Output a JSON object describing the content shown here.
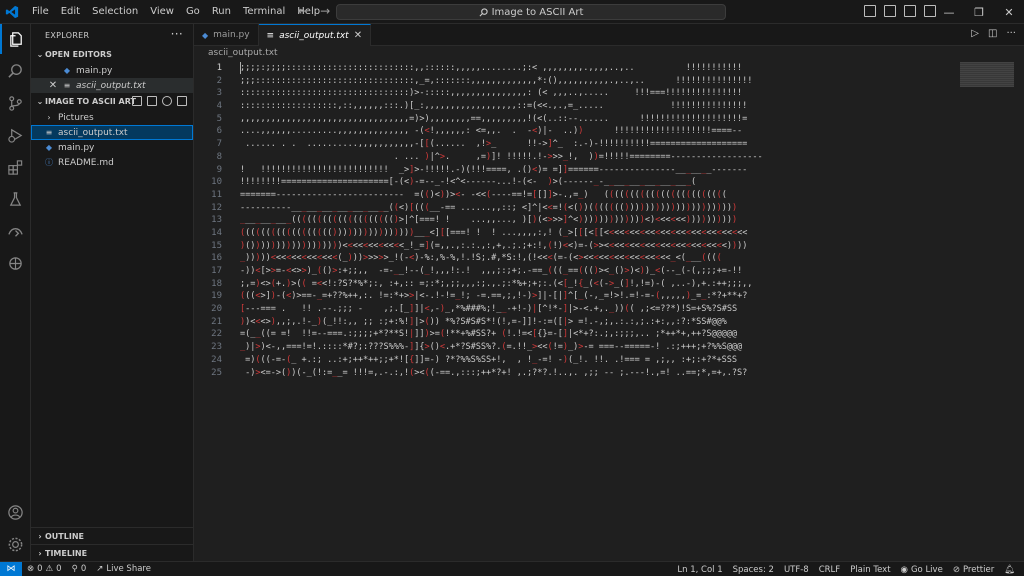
{
  "menu": [
    "File",
    "Edit",
    "Selection",
    "View",
    "Go",
    "Run",
    "Terminal",
    "Help"
  ],
  "search": {
    "text": "Image to ASCII Art"
  },
  "sidebar": {
    "title": "EXPLORER",
    "open_editors_label": "OPEN EDITORS",
    "open_editors": [
      {
        "name": "main.py",
        "icon": "python-file-icon"
      },
      {
        "name": "ascii_output.txt",
        "icon": "text-file-icon"
      }
    ],
    "folder_label": "IMAGE TO ASCII ART",
    "files": [
      {
        "name": "Pictures",
        "kind": "folder"
      },
      {
        "name": "ascii_output.txt",
        "kind": "text"
      },
      {
        "name": "main.py",
        "kind": "python"
      },
      {
        "name": "README.md",
        "kind": "info"
      }
    ],
    "outline_label": "OUTLINE",
    "timeline_label": "TIMELINE"
  },
  "tabs": [
    {
      "label": "main.py",
      "active": false
    },
    {
      "label": "ascii_output.txt",
      "active": true
    }
  ],
  "breadcrumb": "ascii_output.txt",
  "colors": {
    "accent": "#0078d4",
    "red_char": "#d23a3a"
  },
  "code_lines": [
    {
      "n": "1",
      "t": ";;;;:;;;;:::::::::::::::::::::::::,,::::::,,,,,........;:< ,,,,,,,,.,,,,..,..          !!!!!!!!!!!"
    },
    {
      "n": "2",
      "t": ";;;:::::::::::::::::::::::::::::::,_=,:::::::,,,,,,,,,,,,,*:(),,,,,,,,,,.,..,..      !!!!!!!!!!!!!!!"
    },
    {
      "n": "3",
      "t": ":::::::::::::::::::::::::::::::::)>-:::::,,,,,,,,,,,,,,,: (< ,,,..,.....     !!!===!!!!!!!!!!!!!!!"
    },
    {
      "n": "4",
      "t": ":::::::::::::::::::,::,,,,,,:::.)[_:,,,,,,,,,,,,,,,,,,::=(<<.,.,=_.....             !!!!!!!!!!!!!!!"
    },
    {
      "n": "5",
      "t": ",,,,,,,,,,,,,,,,,,,,,,,,,,,,,,,,,=)>),,,,,,,,==,,,,,,,,,!(<(..::--......      !!!!!!!!!!!!!!!!!!!!="
    },
    {
      "n": "6",
      "t": "....,,,,,,.........,,,,,,,,,,,,,, -(<!,,,,,,: <=,,.  .  -<)|-  ..))      !!!!!!!!!!!!!!!!!!!====--"
    },
    {
      "n": "7",
      "t": " ...... . .  ..........,,,,,,,,,,,-[[(......  ,!>_      !!->]^_  :.-)-!!!!!!!!!!==================="
    },
    {
      "n": "8",
      "t": "                              . ... )|^>.     ,=)]! !!!!!.!->>>_!,  ))=!!!!!========------------------"
    },
    {
      "n": "9",
      "t": "!   !!!!!!!!!!!!!!!!!!!!!!!!!  _>]>-!!!!!.-)(!!!====, .()<)= =]]======---------------_______-------"
    },
    {
      "n": "10",
      "t": "!!!!!!!!=====================[-(<)-=--_-!<^<------...!-(<-  )>(------_-_________________("
    },
    {
      "n": "11",
      "t": "=======-------------------------  =(()<))><- -<<(----==!=[[]]>-.,=_)   (((((((((((((((((((((((("
    },
    {
      "n": "12",
      "t": "----------___________________((<)[(((__-== ......,,::; <]^|<<=!(<())((((((())))))))))))))))))))))"
    },
    {
      "n": "13",
      "t": "__________(((((((((((((((((((()>|^[===! !    ...,,..., )[)(<>>>]^<)))))))))))))<)<<<<<<))))))))))"
    },
    {
      "n": "14",
      "t": "(((((((((((((((((())))))))))))))))___<][[===! !  ! ...,,,,:,! (_>[[[<[[<<<<<<<<<<<<<<<<<<<<<<<<<<<<"
    },
    {
      "n": "15",
      "t": ")())))))))))))))))))<<<<<<<<<<<<_!_=](=,,.,:.:.,:,+,.;.;+:!,(!)<<)=-(>><<<<<<<<<<<<<<<<<<<<<<<<))))"
    },
    {
      "n": "16",
      "t": "_)))))<<<<<<<<<<<<<(_)))>>>>>_!(-<)-%:,%-%,!.!S;.#,*S:!,(!<<<(=-(<><<<<<<<<<<<<<<<<<_<(___(((("
    },
    {
      "n": "17",
      "t": "-))<[>>=-<<>>)_(()>:+;;,,  -=-__!--(_!,,,!:.!  ,,,;:;+;.-==_(((_==((()><_()>)<))_<(--_(-(,;;;+=-!!"
    },
    {
      "n": "18",
      "t": ";,=)<>(+.)>(( =<<!:?S?*%*;:, :+,:: =;:*;,;;,,,:;.,.;:*%+;+;:.(<[_!{_(<(->_(]!,!=)-( ,..-),+.:++;;;,,"
    },
    {
      "n": "19",
      "t": "(((<>])-(<)>==-_=+??%++,:. !=:*+>>|<-.!-!=_!; -=.==,;,!-)>]|-[|]^[_(-,_=!>!.=!-=-(,,,,,)_=_:*?+**+?"
    },
    {
      "n": "20",
      "t": "[---=== .   !! .--.;;; -    ,;.[_]]|<,-)_,*%###%;!__-+!-)|[^!*-]|>-<.+,._))(( ,;<=??*)!S=+S%?S#SS"
    },
    {
      "n": "21",
      "t": "))<<<>),,;,.!-_)(_!!:,, ;; :;+:%!]|>()) *%?S#S#S*!(!,=-]]!-:=([|> =!.-,;,.:.:,;.:+:,,:?:*SS#@@%"
    },
    {
      "n": "22",
      "t": "=(__((= =!  !!=--===.:;;;;+*?**S!|]])>=(!**+%#SS?+ (!.!=<[{}=-[]|<*+?:.;,:;;;,.. ;*++*+,++?S@@@@@"
    },
    {
      "n": "23",
      "t": "_)|>)<-,,===!=!.::::*#?;:???S%%%-]]{>()<.+*?S#SS%?.(=.!!_><<(!=)_)>-= ===--=====-! .:;+++;+?%%S@@@"
    },
    {
      "n": "24",
      "t": " =)(((-=-(_ +.:; ..:+;++*++;;+*![{]]=-) ?*?%%S%SS+!,  , !_-=! -)(_!. !!. .!=== = ,;,, :+;:+?*+SSS"
    },
    {
      "n": "25",
      "t": " -)><=->())(-_(!:=__= !!!=,.-.:,!(><((-==.,:::;++*?+! ,.;?*?.!..,. ,;; -- ;.---!.,=! ..==;*,=+,.?S?"
    }
  ],
  "status": {
    "errors": "0",
    "warnings": "0",
    "ports": "0",
    "live_share": "Live Share",
    "position": "Ln 1, Col 1",
    "spaces": "Spaces: 2",
    "encoding": "UTF-8",
    "eol": "CRLF",
    "language": "Plain Text",
    "go_live": "Go Live",
    "prettier": "Prettier"
  }
}
